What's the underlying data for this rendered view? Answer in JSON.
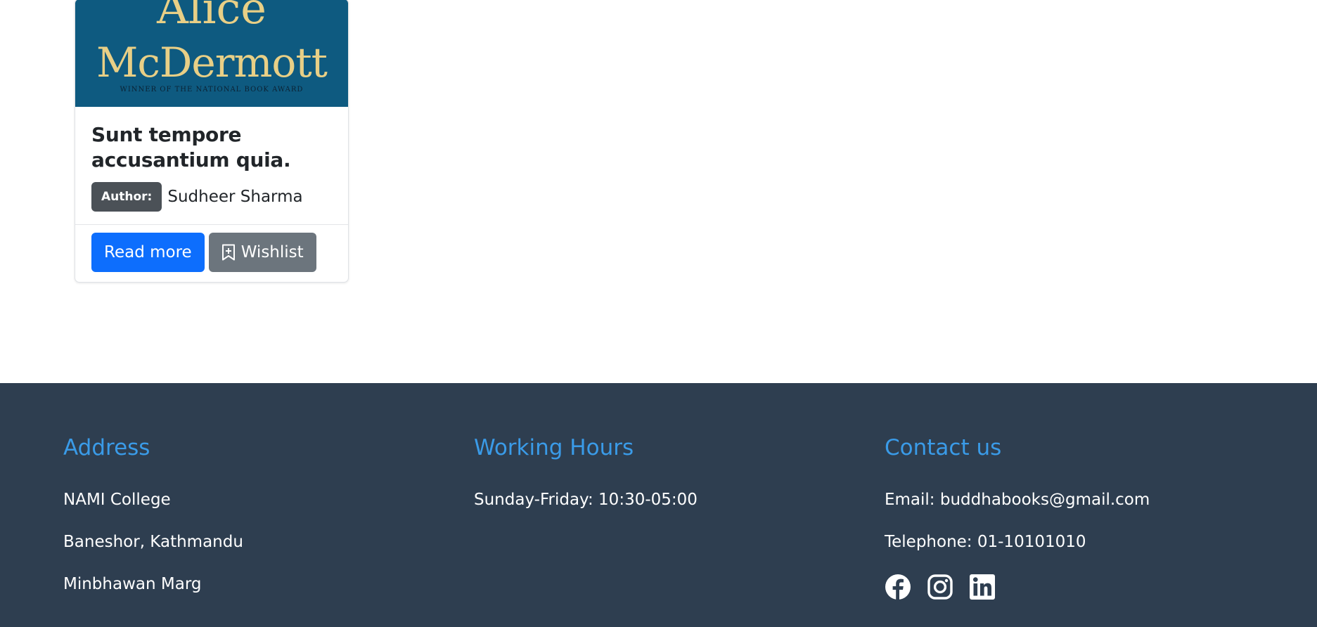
{
  "book": {
    "cover_line1": "Alice",
    "cover_line2": "McDermott",
    "cover_award": "WINNER OF THE NATIONAL BOOK AWARD",
    "title": "Sunt tempore accusantium quia.",
    "author_badge": "Author:",
    "author_name": "Sudheer Sharma",
    "read_more_label": "Read more",
    "wishlist_label": "Wishlist"
  },
  "footer": {
    "address": {
      "heading": "Address",
      "lines": [
        "NAMI College",
        "Baneshor, Kathmandu",
        "Minbhawan Marg"
      ]
    },
    "hours": {
      "heading": "Working Hours",
      "text": "Sunday-Friday: 10:30-05:00"
    },
    "contact": {
      "heading": "Contact us",
      "email": "Email: buddhabooks@gmail.com",
      "telephone": "Telephone: 01-10101010",
      "social_icons": [
        "facebook-icon",
        "instagram-icon",
        "linkedin-icon"
      ]
    }
  },
  "colors": {
    "primary_button": "#0d6efd",
    "secondary_button": "#6c757d",
    "footer_bg": "#2e3e50",
    "footer_heading": "#3a9be8",
    "cover_bg": "#0e5a80"
  }
}
